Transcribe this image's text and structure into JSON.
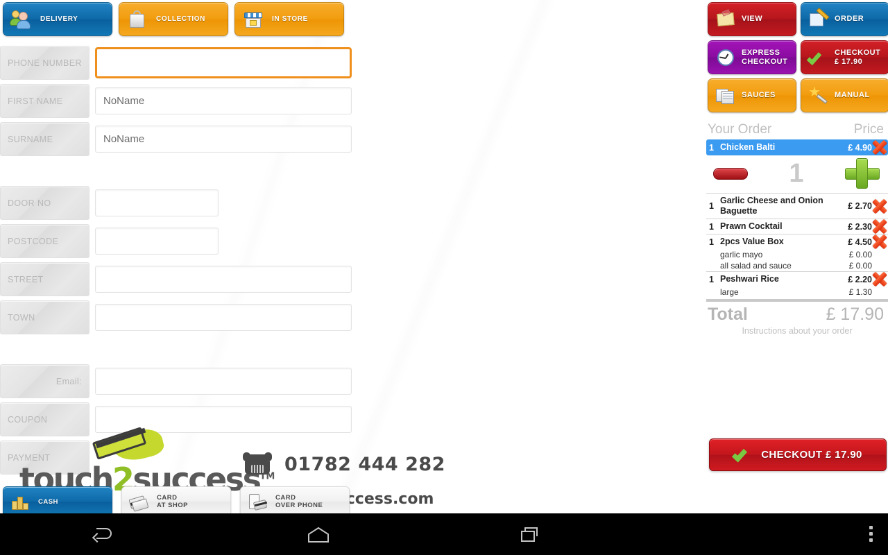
{
  "order_modes": [
    {
      "label": "DELIVERY",
      "icon": "people-icon",
      "selected": true,
      "color": "#0e69a8"
    },
    {
      "label": "COLLECTION",
      "icon": "shopping-bag-icon",
      "selected": false,
      "color": "#f29d10"
    },
    {
      "label": "IN STORE",
      "icon": "storefront-icon",
      "selected": false,
      "color": "#f29d10"
    }
  ],
  "form": {
    "fields": [
      {
        "label": "PHONE NUMBER",
        "value": "",
        "placeholder": "",
        "size": "wide",
        "focused": true,
        "label_align": "left"
      },
      {
        "label": "FIRST NAME",
        "value": "NoName",
        "placeholder": "",
        "size": "wide",
        "focused": false,
        "label_align": "left"
      },
      {
        "label": "SURNAME",
        "value": "NoName",
        "placeholder": "",
        "size": "wide",
        "focused": false,
        "label_align": "left"
      },
      {
        "label": "DOOR NO",
        "value": "",
        "placeholder": "",
        "size": "short",
        "focused": false,
        "label_align": "left"
      },
      {
        "label": "POSTCODE",
        "value": "",
        "placeholder": "",
        "size": "short",
        "focused": false,
        "label_align": "left"
      },
      {
        "label": "STREET",
        "value": "",
        "placeholder": "",
        "size": "wide",
        "focused": false,
        "label_align": "left"
      },
      {
        "label": "TOWN",
        "value": "",
        "placeholder": "",
        "size": "wide",
        "focused": false,
        "label_align": "left"
      },
      {
        "label": "Email:",
        "value": "",
        "placeholder": "",
        "size": "wide",
        "focused": false,
        "label_align": "right"
      },
      {
        "label": "COUPON",
        "value": "",
        "placeholder": "",
        "size": "wide",
        "focused": false,
        "label_align": "left"
      }
    ],
    "payment_label": "PAYMENT"
  },
  "payment_methods": [
    {
      "label_line1": "CASH",
      "label_line2": "",
      "icon": "cash-icon",
      "selected": true
    },
    {
      "label_line1": "CARD",
      "label_line2": "AT SHOP",
      "icon": "credit-card-icon",
      "selected": false
    },
    {
      "label_line1": "CARD",
      "label_line2": "OVER PHONE",
      "icon": "phone-card-icon",
      "selected": false
    }
  ],
  "branding": {
    "name_part1": "touch",
    "name_part2": "2",
    "name_part3": "success",
    "tm": "TM",
    "phone": "01782 444 282",
    "website": "success.com"
  },
  "right_buttons": [
    {
      "label": "VIEW",
      "icon": "note-icon",
      "color": "#b5161c",
      "style": "red"
    },
    {
      "label": "ORDER",
      "icon": "pencil-edit-icon",
      "color": "#0e69a8",
      "style": "blue2"
    },
    {
      "label": "EXPRESS CHECKOUT",
      "label_line1": "EXPRESS",
      "label_line2": "CHECKOUT",
      "icon": "clock-icon",
      "color": "#8a0ba0",
      "style": "purple"
    },
    {
      "label": "CHECKOUT £ 17.90",
      "label_line1": "CHECKOUT",
      "label_line2": "£ 17.90",
      "icon": "green-check-icon",
      "color": "#b5161c",
      "style": "red"
    },
    {
      "label": "SAUCES",
      "icon": "sauces-list-icon",
      "color": "#f29d10",
      "style": "orange2"
    },
    {
      "label": "MANUAL",
      "icon": "magic-wand-icon",
      "color": "#f29d10",
      "style": "orange2"
    }
  ],
  "order": {
    "header_item": "Your Order",
    "header_price": "Price",
    "items": [
      {
        "qty": "1",
        "name": "Chicken Balti",
        "price": "£ 4.90",
        "selected": true,
        "options": []
      },
      {
        "qty": "1",
        "name": "Garlic Cheese and Onion Baguette",
        "price": "£ 2.70",
        "selected": false,
        "options": []
      },
      {
        "qty": "1",
        "name": "Prawn Cocktail",
        "price": "£ 2.30",
        "selected": false,
        "options": []
      },
      {
        "qty": "1",
        "name": "2pcs Value Box",
        "price": "£ 4.50",
        "selected": false,
        "options": [
          {
            "name": "garlic mayo",
            "price": "£ 0.00"
          },
          {
            "name": "all salad and sauce",
            "price": "£ 0.00"
          }
        ]
      },
      {
        "qty": "1",
        "name": "Peshwari Rice",
        "price": "£ 2.20",
        "selected": false,
        "options": [
          {
            "name": "large",
            "price": "£ 1.30"
          }
        ]
      }
    ],
    "stepper_qty": "1",
    "total_label": "Total",
    "total_value": "£ 17.90",
    "instructions": "Instructions about your order",
    "checkout_label": "CHECKOUT £ 17.90"
  },
  "navbar": {
    "back": "back-icon",
    "home": "home-icon",
    "recents": "recent-apps-icon",
    "menu": "overflow-menu-icon"
  }
}
